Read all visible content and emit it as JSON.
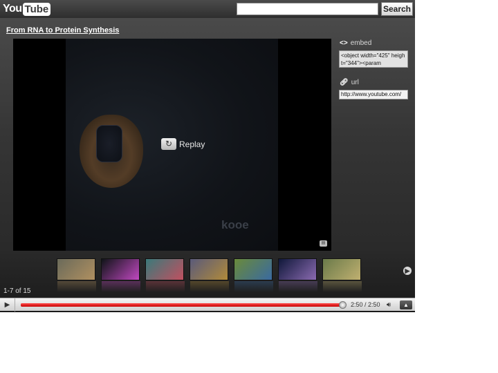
{
  "header": {
    "logo_you": "You",
    "logo_tube": "Tube",
    "search_value": "",
    "search_button_label": "Search"
  },
  "video": {
    "title": "From RNA to Protein Synthesis",
    "replay_label": "Replay",
    "watermark": "kooe"
  },
  "sidebar": {
    "embed_label": "embed",
    "embed_code": "<object width=\"425\" height=\"344\"><param",
    "url_label": "url",
    "url_value": "http://www.youtube.com/"
  },
  "related": {
    "count_label": "1-7 of 15",
    "thumbnails": [
      {
        "name": "thumbnail-1",
        "colors": [
          "#6a6a5a",
          "#b09060"
        ]
      },
      {
        "name": "thumbnail-2",
        "colors": [
          "#101418",
          "#c048c0"
        ]
      },
      {
        "name": "thumbnail-3",
        "colors": [
          "#3a7a7a",
          "#c05060"
        ]
      },
      {
        "name": "thumbnail-4",
        "colors": [
          "#5a5a7a",
          "#b08a3a"
        ]
      },
      {
        "name": "thumbnail-5",
        "colors": [
          "#6a8a3a",
          "#3a6aa0"
        ]
      },
      {
        "name": "thumbnail-6",
        "colors": [
          "#10183a",
          "#8a6ab0"
        ]
      },
      {
        "name": "thumbnail-7",
        "colors": [
          "#6a7a4a",
          "#c0b070"
        ]
      }
    ]
  },
  "controls": {
    "time_display": "2:50 / 2:50",
    "progress_fraction": 1.0
  },
  "colors": {
    "progress": "#cc0000",
    "player_background": "#3a3a3a"
  }
}
